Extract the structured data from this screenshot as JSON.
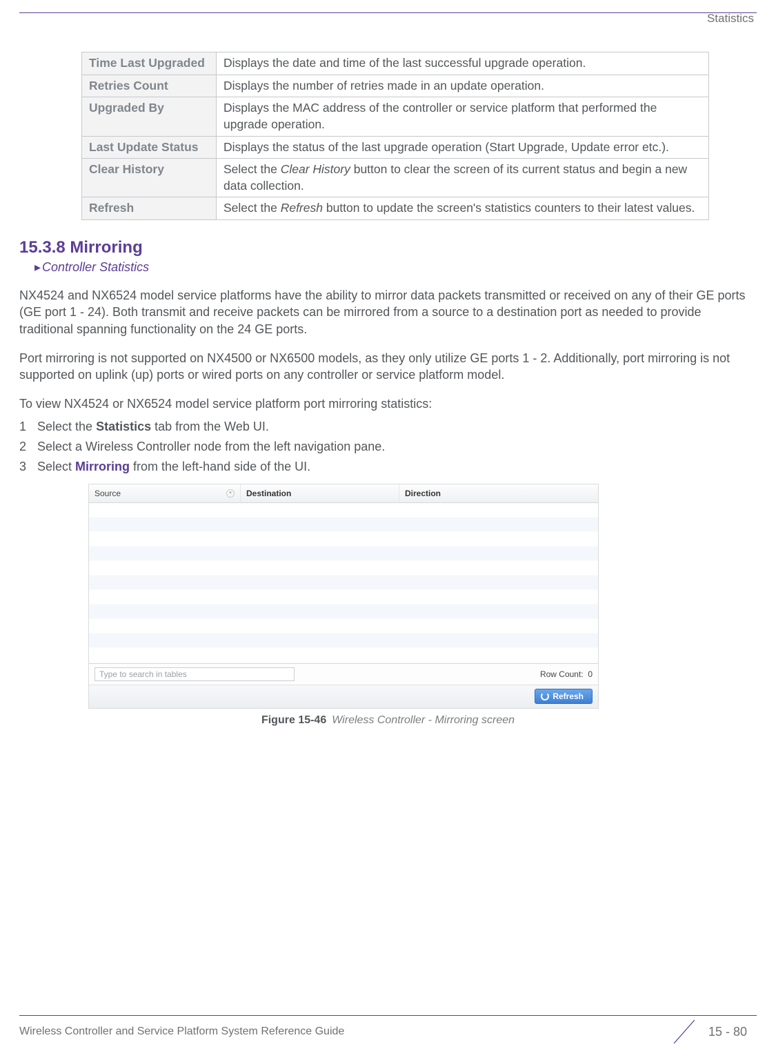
{
  "header": {
    "section_label": "Statistics"
  },
  "param_table": [
    {
      "label": "Time Last Upgraded",
      "desc": "Displays the date and time of the last successful upgrade operation."
    },
    {
      "label": "Retries Count",
      "desc": "Displays the number of retries made in an update operation."
    },
    {
      "label": "Upgraded By",
      "desc": "Displays the MAC address of the controller or service platform that performed the upgrade operation."
    },
    {
      "label": "Last Update Status",
      "desc": "Displays the status of the last upgrade operation (Start Upgrade, Update error etc.)."
    },
    {
      "label": "Clear History",
      "desc_pre": "Select the ",
      "desc_em": "Clear History",
      "desc_post": " button to clear the screen of its current status and begin a new data collection."
    },
    {
      "label": "Refresh",
      "desc_pre": "Select the ",
      "desc_em": "Refresh",
      "desc_post": " button to update the screen's statistics counters to their latest values."
    }
  ],
  "section": {
    "number_title": "15.3.8 Mirroring",
    "breadcrumb": "Controller Statistics"
  },
  "paragraphs": {
    "p1": "NX4524 and NX6524 model service platforms have the ability to mirror data packets transmitted or received on any of their GE ports (GE port 1 - 24). Both transmit and receive packets can be mirrored from a source to a destination port as needed to provide traditional spanning functionality on the 24 GE ports.",
    "p2": "Port mirroring is not supported on NX4500 or NX6500 models, as they only utilize GE ports 1 - 2. Additionally, port mirroring is not supported on uplink (up) ports or wired ports on any controller or service platform model.",
    "p3": "To view NX4524 or NX6524 model service platform port mirroring statistics:"
  },
  "steps": [
    {
      "num": "1",
      "pre": "Select the ",
      "bold": "Statistics",
      "post": " tab from the Web UI."
    },
    {
      "num": "2",
      "pre": "Select a Wireless Controller node from the left navigation pane.",
      "bold": "",
      "post": ""
    },
    {
      "num": "3",
      "pre": "Select ",
      "bold": "Mirroring",
      "post": " from the left-hand side of the UI."
    }
  ],
  "screenshot": {
    "columns": {
      "c1": "Source",
      "c2": "Destination",
      "c3": "Direction"
    },
    "search_placeholder": "Type to search in tables",
    "row_count_label": "Row Count:",
    "row_count_value": "0",
    "refresh_label": "Refresh"
  },
  "figure": {
    "num": "Figure 15-46",
    "title": "Wireless Controller - Mirroring screen"
  },
  "footer": {
    "guide": "Wireless Controller and Service Platform System Reference Guide",
    "page": "15 - 80"
  }
}
